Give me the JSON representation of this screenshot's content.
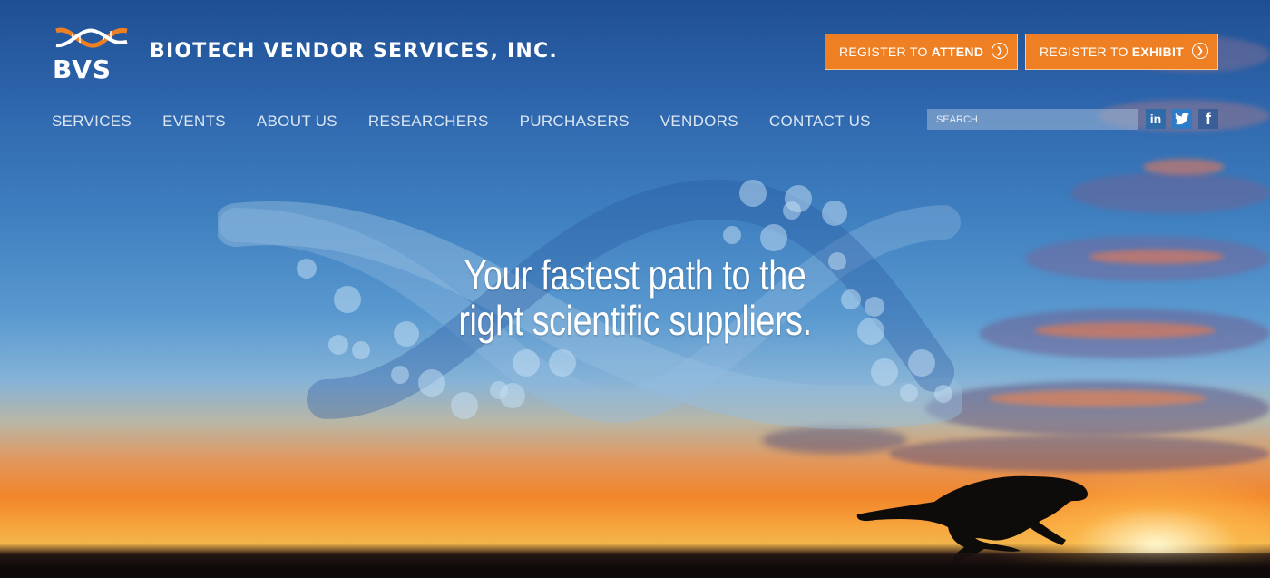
{
  "brand": {
    "logo_text": "BVS",
    "company_name": "BIOTECH VENDOR SERVICES, INC."
  },
  "header": {
    "register_attend": {
      "prefix": "REGISTER TO",
      "emphasis": "ATTEND"
    },
    "register_exhibit": {
      "prefix": "REGISTER TO",
      "emphasis": "EXHIBIT"
    }
  },
  "nav": {
    "items": [
      "SERVICES",
      "EVENTS",
      "ABOUT US",
      "RESEARCHERS",
      "PURCHASERS",
      "VENDORS",
      "CONTACT US"
    ]
  },
  "search": {
    "placeholder": "SEARCH"
  },
  "social": {
    "linkedin": "in",
    "twitter": "twitter-icon",
    "facebook": "f"
  },
  "hero": {
    "headline_line1": "Your fastest path to the",
    "headline_line2": "right scientific suppliers."
  },
  "colors": {
    "accent": "#ee7f22",
    "sky_top": "#1f4f93",
    "sunset": "#f2852a"
  }
}
